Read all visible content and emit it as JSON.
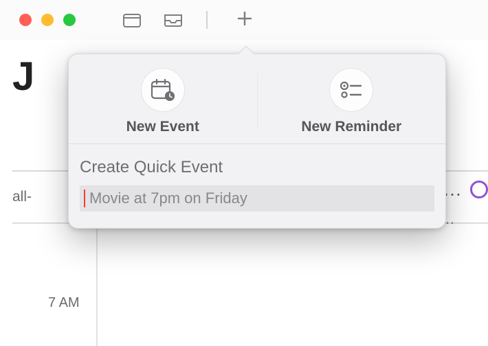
{
  "titlebar": {
    "traffic_lights": {
      "close_color": "#ff5f57",
      "minimize_color": "#febc2e",
      "zoom_color": "#28c840"
    }
  },
  "background": {
    "month_prefix": "J",
    "allday_label": "all-",
    "time_label": "7 AM",
    "purple_ring_color": "#9152d6"
  },
  "popover": {
    "new_event_label": "New Event",
    "new_reminder_label": "New Reminder",
    "quick_title": "Create Quick Event",
    "quick_placeholder": "Movie at 7pm on Friday"
  }
}
